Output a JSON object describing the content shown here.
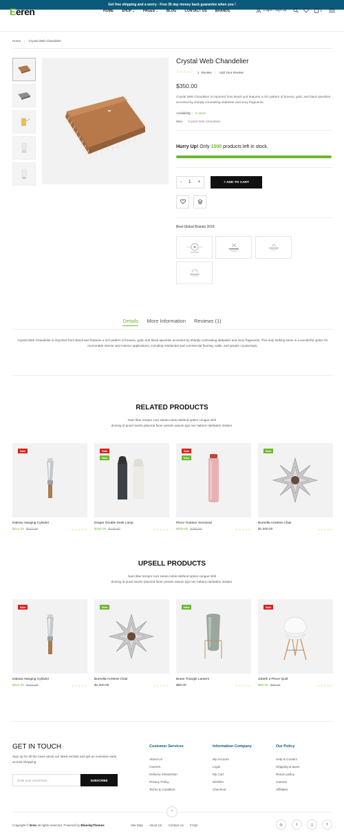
{
  "topbar": {
    "text": "Get free shipping and a worry - Free 30 day money back guarantee when you !"
  },
  "brand": {
    "logo_first": "E",
    "logo_rest": "eren",
    "accent": "#6fb82f",
    "navy": "#0b5a7c"
  },
  "nav": {
    "items": [
      "HOME",
      "SHOP",
      "PAGES",
      "BLOG",
      "CONTACT US",
      "BRANDS"
    ]
  },
  "header": {
    "login": "Login / Sign up",
    "cart_count": "0"
  },
  "breadcrumb": {
    "home": "Home",
    "current": "Crystal Web Chandelier"
  },
  "product": {
    "title": "Crystal Web Chandelier",
    "rating_stars": "☆☆☆☆☆",
    "review_count": "1",
    "review_label": "Review",
    "add_review": "Add Your Review",
    "price": "$350.00",
    "description": "Crystal Web Chandelier is imported from Brazil and features a rich pattern of browns, gold, and black speckles accented by sharply contrasting alabaster and ivory fragments.",
    "availability_label": "Availability :",
    "availability_value": "In stock",
    "sku_label": "SKU :",
    "sku_value": "Crystal Web Chandelier",
    "hurry_prefix": "Hurry Up!",
    "hurry_mid": "Only",
    "hurry_count": "1000",
    "hurry_suffix": "products left in stock.",
    "stock_fill": 1.0,
    "qty_minus": "-",
    "qty_value": "1",
    "qty_plus": "+",
    "add_to_cart": "+  ADD TO CART",
    "brands_label": "Best Global Brands 2019:"
  },
  "tabs": {
    "items": [
      "Details",
      "More Information",
      "Reviews (1)"
    ]
  },
  "details_text": "Crystal Web Chandelier is imported from Brazil and features a rich pattern of browns, gold, and black speckles accented by sharply contrasting alabaster and ivory fragments. This truly striking stone is a wonderful option for memorable interior and exterior applications, including residential and commercial flooring, walls, and granite countertops.",
  "related": {
    "title": "RELATED PRODUCTS",
    "sub1": "Nam liber tempor cum soluta nobis eleifend option congue nihil",
    "sub2": "doming id quod mazim placerat facer possim assum typi non habent claritatem insitam.",
    "items": [
      {
        "name": "Dakota Hanging Cylinder",
        "price": "$211.00",
        "old": "$222.00",
        "badges": [
          "Sale"
        ]
      },
      {
        "name": "Draper Double Desk Lamp",
        "price": "$150.00",
        "old": "$175.00",
        "badges": [
          "Sale",
          "New"
        ]
      },
      {
        "name": "Piece Outdoor Sectional",
        "price": "$320.00",
        "old": "$330.00",
        "badges": [
          "Sale",
          "New"
        ]
      },
      {
        "name": "Burnella Armless Chair",
        "price": "$1,000.00",
        "old": "",
        "badges": [
          "New"
        ]
      }
    ]
  },
  "upsell": {
    "title": "UPSELL PRODUCTS",
    "sub1": "Nam liber tempor cum soluta nobis eleifend option congue nihil",
    "sub2": "doming id quod mazim placerat facer possim assum typi non habent claritatem insitam.",
    "items": [
      {
        "name": "Dakota Hanging Cylinder",
        "price": "$211.00",
        "old": "$222.00",
        "badges": [
          "Sale"
        ]
      },
      {
        "name": "Burnella Armless Chair",
        "price": "$1,000.00",
        "old": "",
        "badges": [
          "New"
        ]
      },
      {
        "name": "Brass Triangle Lantern",
        "price": "$99.00",
        "old": "",
        "badges": [
          "New"
        ]
      },
      {
        "name": "Jobeth 2-Piece Quilt",
        "price": "$69.00",
        "old": "$99.00",
        "badges": [
          "Sale"
        ]
      }
    ]
  },
  "card_stars": "☆☆☆☆☆",
  "footer": {
    "title": "GET IN TOUCH",
    "sub": "Sign up for all the news about our latest arrivals and get an exclusive early access shopping.",
    "email_placeholder": "Enter your email here...",
    "subscribe": "SUBSCRIBE",
    "cols": [
      {
        "heading": "Customer Services",
        "links": [
          "About Us",
          "Careers",
          "Delivery Inforamtion",
          "Privacy Policy",
          "Terms & Condition"
        ]
      },
      {
        "heading": "Information Company",
        "links": [
          "My Account",
          "Login",
          "My Cart",
          "Wishlist",
          "Checkout"
        ]
      },
      {
        "heading": "Our Policy",
        "links": [
          "Help & Contact",
          "Shipping & taxes",
          "Return policy",
          "Careers",
          "Affiliates"
        ]
      }
    ],
    "copyright_pre": "Copyright ©",
    "copyright_brand": "Eren",
    "copyright_mid": "all rights reserved. Powered by",
    "copyright_by": "BlueskyThemes",
    "links": [
      "Site Map",
      "About Us",
      "Contact Us",
      "FAQs"
    ],
    "social": [
      "◎",
      "t",
      "◻",
      "f"
    ]
  }
}
